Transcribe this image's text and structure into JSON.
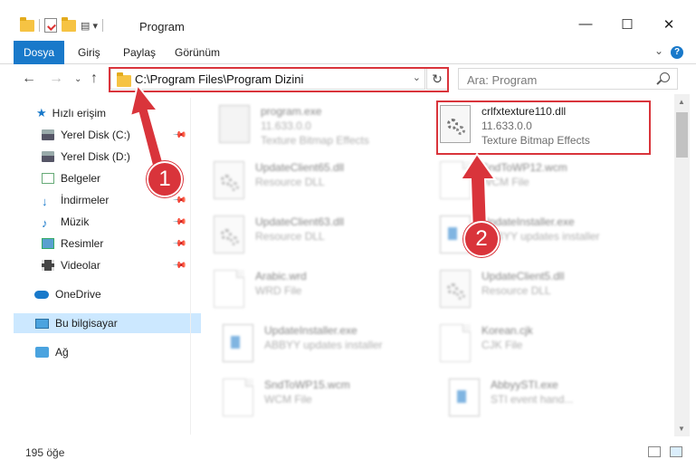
{
  "window": {
    "title": "Program",
    "minimize": "—",
    "maximize": "☐",
    "close": "✕"
  },
  "ribbon": {
    "tabs": [
      "Dosya",
      "Giriş",
      "Paylaş",
      "Görünüm"
    ],
    "help": "?"
  },
  "address": {
    "path": "C:\\Program Files\\Program Dizini",
    "dropdown": "⌄",
    "refresh": "↻"
  },
  "search": {
    "placeholder": "Ara: Program"
  },
  "sidebar": {
    "items": [
      {
        "label": "Hızlı erişim",
        "icon": "star-icon"
      },
      {
        "label": "Yerel Disk (C:)",
        "icon": "drive-icon"
      },
      {
        "label": "Yerel Disk (D:)",
        "icon": "drive-icon"
      },
      {
        "label": "Belgeler",
        "icon": "documents-icon"
      },
      {
        "label": "İndirmeler",
        "icon": "downloads-icon"
      },
      {
        "label": "Müzik",
        "icon": "music-icon"
      },
      {
        "label": "Resimler",
        "icon": "pictures-icon"
      },
      {
        "label": "Videolar",
        "icon": "videos-icon"
      },
      {
        "label": "OneDrive",
        "icon": "cloud-icon"
      },
      {
        "label": "Bu bilgisayar",
        "icon": "computer-icon"
      },
      {
        "label": "Ağ",
        "icon": "network-icon"
      }
    ]
  },
  "files": [
    {
      "name": "program.exe",
      "line2": "11.633.0.0",
      "line3": "Texture Bitmap Effects"
    },
    {
      "name": "crlfxtexture110.dll",
      "line2": "11.633.0.0",
      "line3": "Texture Bitmap Effects"
    },
    {
      "name": "UpdateClient65.dll",
      "line2": "Resource DLL"
    },
    {
      "name": "SndToWP12.wcm",
      "line2": "WCM File"
    },
    {
      "name": "UpdateClient63.dll",
      "line2": "Resource DLL"
    },
    {
      "name": "UpdateInstaller.exe",
      "line2": "ABBYY updates installer"
    },
    {
      "name": "Arabic.wrd",
      "line2": "WRD File"
    },
    {
      "name": "UpdateClient5.dll",
      "line2": "Resource DLL"
    },
    {
      "name": "UpdateInstaller.exe",
      "line2": "ABBYY updates installer"
    },
    {
      "name": "Korean.cjk",
      "line2": "CJK File"
    },
    {
      "name": "SndToWP15.wcm",
      "line2": "WCM File"
    },
    {
      "name": "AbbyySTI.exe",
      "line2": "STI event hand..."
    }
  ],
  "status": {
    "count": "195 öğe"
  },
  "annotations": {
    "step1": "1",
    "step2": "2"
  },
  "colors": {
    "accent": "#1979ca",
    "highlight": "#d9343b",
    "selected": "#cce8ff"
  }
}
